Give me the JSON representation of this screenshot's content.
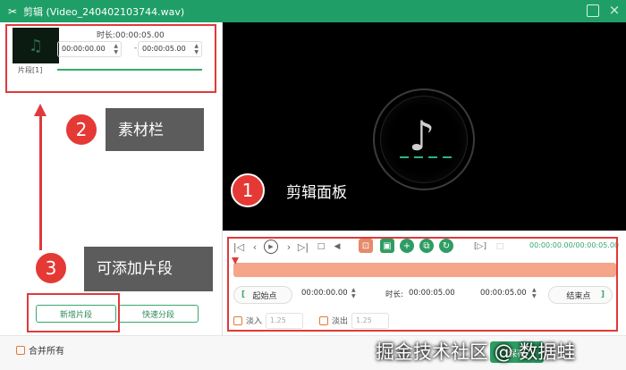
{
  "window": {
    "title": "剪辑 (Video_240402103744.wav)",
    "accent": "#1f9f67"
  },
  "clip": {
    "duration_label": "时长:00:00:05.00",
    "start_time": "00:00:00.00",
    "end_time": "00:00:05.00",
    "separator": "-",
    "segment_label": "片段[1]"
  },
  "left_buttons": {
    "add_segment": "新增片段",
    "quick_split": "快速分段"
  },
  "annotations": {
    "a1": {
      "number": "1",
      "text": "剪辑面板"
    },
    "a2": {
      "number": "2",
      "text": "素材栏"
    },
    "a3": {
      "number": "3",
      "text": "可添加片段"
    },
    "color": "#e03a3a"
  },
  "timeline": {
    "current_total": "00:00:00.00/00:00:05.00",
    "start_btn": "起始点",
    "start_value": "00:00:00.00",
    "duration_label": "时长:",
    "duration_value": "00:00:05.00",
    "end_value": "00:00:05.00",
    "end_btn": "结束点",
    "bracket_left": "[",
    "bracket_right": "]",
    "fade_in_label": "淡入",
    "fade_in_value": "1.25",
    "fade_out_label": "淡出",
    "fade_out_value": "1.25"
  },
  "footer": {
    "merge_all": "合并所有",
    "save_btn": "保存",
    "watermark": "掘金技术社区 @ 数据蛙"
  }
}
